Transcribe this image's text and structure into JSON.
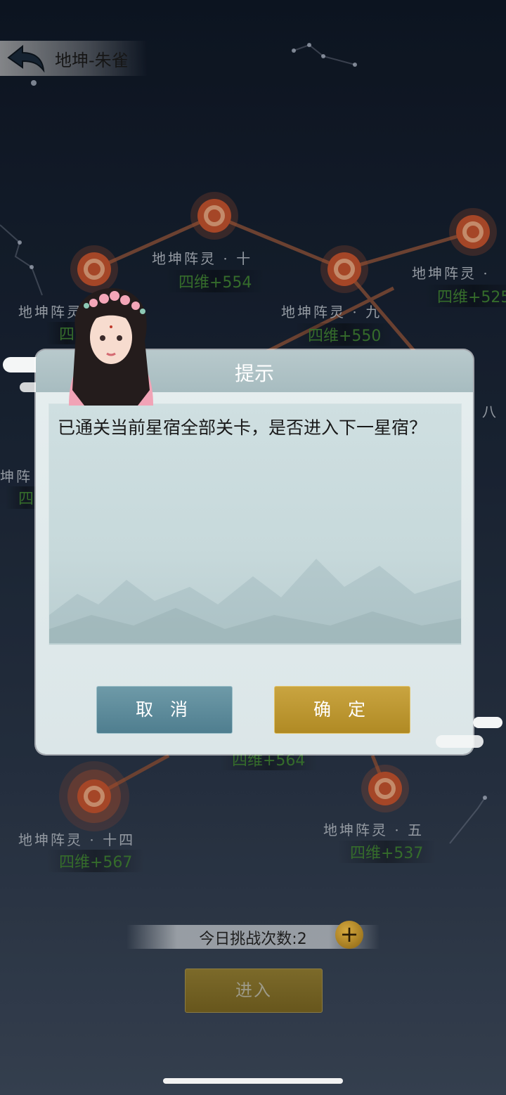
{
  "header": {
    "title": "地坤-朱雀"
  },
  "map_nodes": [
    {
      "label": "地坤阵灵 · 十",
      "value": "四维+554"
    },
    {
      "label": "地坤阵灵 · 九",
      "value": "四维+550"
    },
    {
      "label": "地坤阵灵 ·",
      "value": "四维+525"
    },
    {
      "label": "地坤阵灵 · 十一",
      "value": "四"
    },
    {
      "label": "地坤阵灵 · 十四",
      "value": "四维+567"
    },
    {
      "label": "地坤阵灵 · 五",
      "value": "四维+537"
    },
    {
      "label": "坤阵",
      "value": "四"
    },
    {
      "label": "八",
      "value": ""
    },
    {
      "label": "",
      "value": "四维+564"
    }
  ],
  "dialog": {
    "title": "提示",
    "message": "已通关当前星宿全部关卡，是否进入下一星宿？",
    "cancel_label": "取 消",
    "ok_label": "确 定"
  },
  "footer": {
    "challenge_text": "今日挑战次数:2",
    "plus_label": "+",
    "enter_label": "进入"
  },
  "colors": {
    "ok_gold": "#b99230",
    "cancel_teal": "#5a8898",
    "value_green": "#3f7f33"
  }
}
